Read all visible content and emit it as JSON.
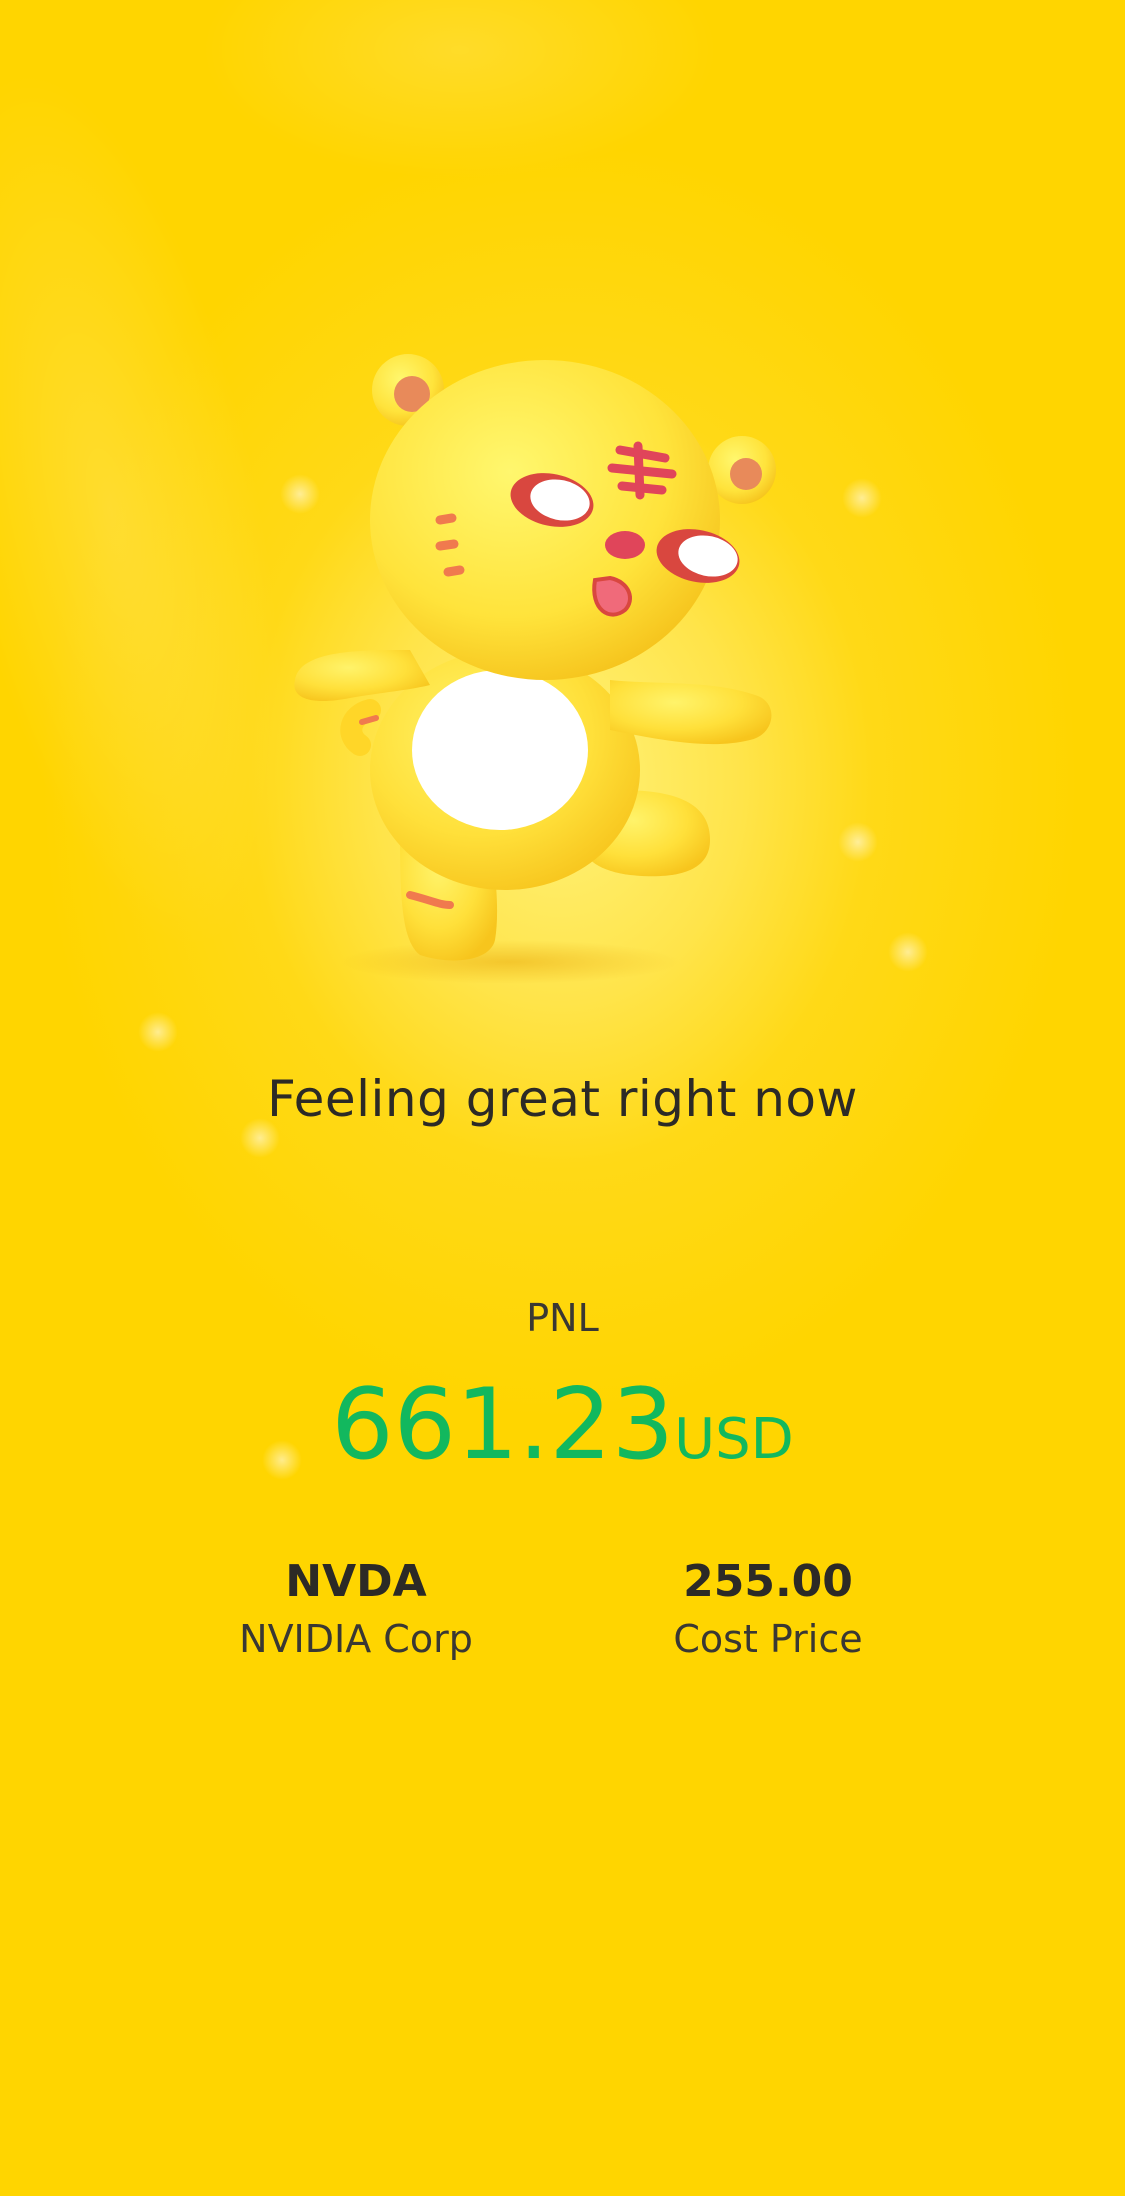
{
  "mood": {
    "text": "Feeling great right now"
  },
  "pnl": {
    "label": "PNL",
    "amount": "661.23",
    "unit": "USD",
    "color": "#12b85e"
  },
  "stock": {
    "ticker": "NVDA",
    "name": "NVIDIA Corp"
  },
  "cost": {
    "value": "255.00",
    "label": "Cost Price"
  },
  "theme": {
    "background": "#ffd500",
    "text": "#2c2a26"
  },
  "icons": {
    "mascot": "tiger-mascot-icon"
  }
}
